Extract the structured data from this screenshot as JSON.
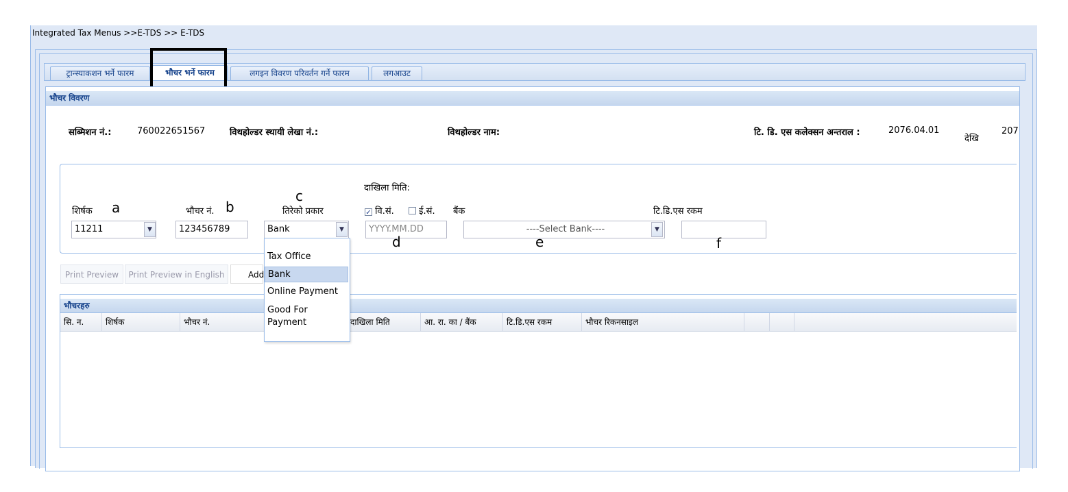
{
  "breadcrumb": "Integrated Tax Menus >>E-TDS >> E-TDS",
  "tabs": [
    {
      "label": "ट्रान्स्याकशन भर्ने फारम"
    },
    {
      "label": "भौचर भर्ने फारम"
    },
    {
      "label": "लगइन विवरण परिवर्तन गर्ने फारम"
    },
    {
      "label": "लगआउट"
    }
  ],
  "voucher_details": {
    "title": "भौचर विवरण",
    "submission_label": "सब्मिशन नं.:",
    "submission_value": "760022651567",
    "withholder_pan_label": "विथहोल्डर स्थायी लेखा नं.:",
    "withholder_name_label": "विथहोल्डर नाम:",
    "collection_period_label": "टि. डि. एस कलेक्सन अन्तराल :",
    "collection_period_from": "2076.04.01",
    "from_word": "देखि",
    "collection_period_to": "207"
  },
  "form": {
    "heading_label": "शिर्षक",
    "heading_value": "11211",
    "voucher_no_label": "भौचर नं.",
    "voucher_no_value": "123456789",
    "payment_type_label": "तिरेको प्रकार",
    "payment_type_value": "Bank",
    "deposit_date_label": "दाखिला मिति:",
    "date_bs_label": "वि.सं.",
    "date_bs_checked": true,
    "date_ad_label": "ई.सं.",
    "date_ad_checked": false,
    "date_placeholder": "YYYY.MM.DD",
    "bank_label": "बैंक",
    "bank_placeholder": "----Select Bank----",
    "tds_amount_label": "टि.डि.एस रकम",
    "tds_amount_value": ""
  },
  "annotations": {
    "a": "a",
    "b": "b",
    "c": "c",
    "d": "d",
    "e": "e",
    "f": "f"
  },
  "buttons": {
    "print_preview": "Print Preview",
    "print_preview_english": "Print Preview in English",
    "add": "Add"
  },
  "payment_type_options": [
    "Tax Office",
    "Bank",
    "Online Payment",
    "Good For Payment"
  ],
  "payment_type_selected_index": 1,
  "vouchers_grid": {
    "title": "भौचरहरु",
    "columns": [
      "सि. न.",
      "शिर्षक",
      "भौचर नं.",
      "",
      "दाखिला मिति",
      "आ. रा. का / बैंक",
      "टि.डि.एस रकम",
      "भौचर रिकनसाइल",
      "",
      ""
    ],
    "rows": []
  },
  "colors": {
    "panel_bg": "#dfe8f6",
    "border": "#99bbe8",
    "header_text": "#15428b",
    "selected_option": "#c8d8ef"
  }
}
